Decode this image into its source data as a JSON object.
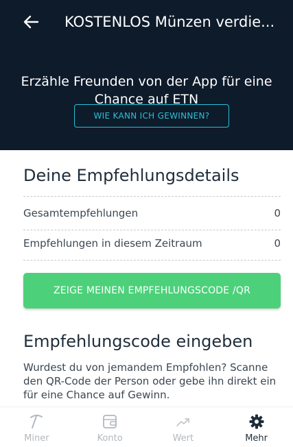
{
  "header": {
    "back_icon": "arrow-left-icon",
    "title": "KOSTENLOS Münzen verdie..."
  },
  "hero": {
    "text": "Erzähle Freunden von der App für eine Chance auf ETN",
    "how_button": "WIE KANN ICH GEWINNEN?"
  },
  "referral": {
    "title": "Deine Empfehlungsdetails",
    "rows": [
      {
        "label": "Gesamtempfehlungen",
        "value": "0"
      },
      {
        "label": "Empfehlungen in diesem Zeitraum",
        "value": "0"
      }
    ],
    "code_button": "ZEIGE MEINEN EMPFEHLUNGSCODE /QR"
  },
  "enter_code": {
    "title": "Empfehlungscode eingeben",
    "text": "Wurdest du von jemandem Empfohlen? Scanne den QR-Code der Person oder gebe ihn direkt ein für eine Chance auf Gewinn."
  },
  "nav": {
    "items": [
      {
        "label": "Miner",
        "icon": "pickaxe-icon",
        "active": false
      },
      {
        "label": "Konto",
        "icon": "wallet-icon",
        "active": false
      },
      {
        "label": "Wert",
        "icon": "trend-up-icon",
        "active": false
      },
      {
        "label": "Mehr",
        "icon": "gear-icon",
        "active": true
      }
    ]
  },
  "colors": {
    "hero_bg": "#0e1b2b",
    "accent_cyan": "#2ac0d6",
    "button_green": "#4cd17a"
  }
}
